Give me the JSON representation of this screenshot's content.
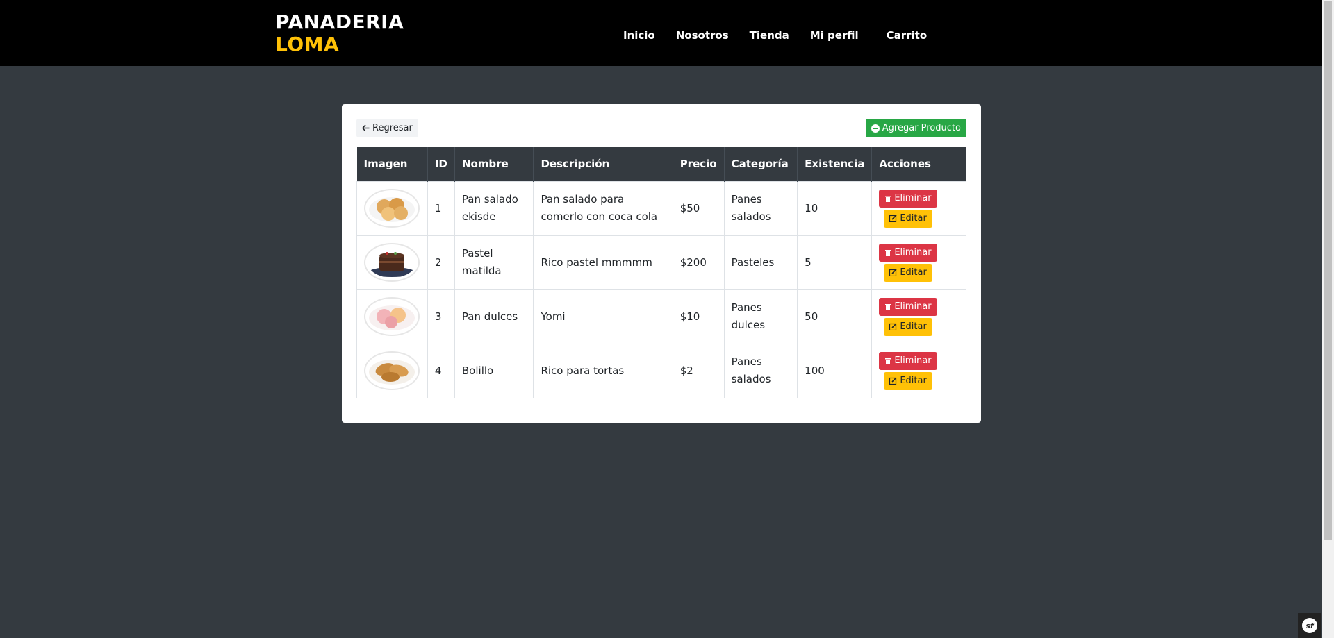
{
  "brand": {
    "line1": "PANADERIA",
    "line2": "LOMA"
  },
  "nav": {
    "items": [
      "Inicio",
      "Nosotros",
      "Tienda",
      "Mi perfil",
      "Carrito"
    ]
  },
  "toolbar": {
    "back_label": "Regresar",
    "add_label": "Agregar Producto"
  },
  "table": {
    "headers": [
      "Imagen",
      "ID",
      "Nombre",
      "Descripción",
      "Precio",
      "Categoría",
      "Existencia",
      "Acciones"
    ],
    "rows": [
      {
        "id": "1",
        "name": "Pan salado ekisde",
        "description": "Pan salado para comerlo con coca cola",
        "price": "$50",
        "category": "Panes salados",
        "stock": "10",
        "image": "bread-rolls"
      },
      {
        "id": "2",
        "name": "Pastel matilda",
        "description": "Rico pastel mmmmm",
        "price": "$200",
        "category": "Pasteles",
        "stock": "5",
        "image": "chocolate-cake"
      },
      {
        "id": "3",
        "name": "Pan dulces",
        "description": "Yomi",
        "price": "$10",
        "category": "Panes dulces",
        "stock": "50",
        "image": "sweet-buns"
      },
      {
        "id": "4",
        "name": "Bolillo",
        "description": "Rico para tortas",
        "price": "$2",
        "category": "Panes salados",
        "stock": "100",
        "image": "bolillo-bread"
      }
    ],
    "delete_label": "Eliminar",
    "edit_label": "Editar"
  },
  "footer_badge": "sf",
  "colors": {
    "header_bg": "#000000",
    "page_bg": "#343a40",
    "brand_accent": "#ffc107",
    "add": "#28a745",
    "delete": "#dc3545",
    "edit": "#ffc107"
  }
}
